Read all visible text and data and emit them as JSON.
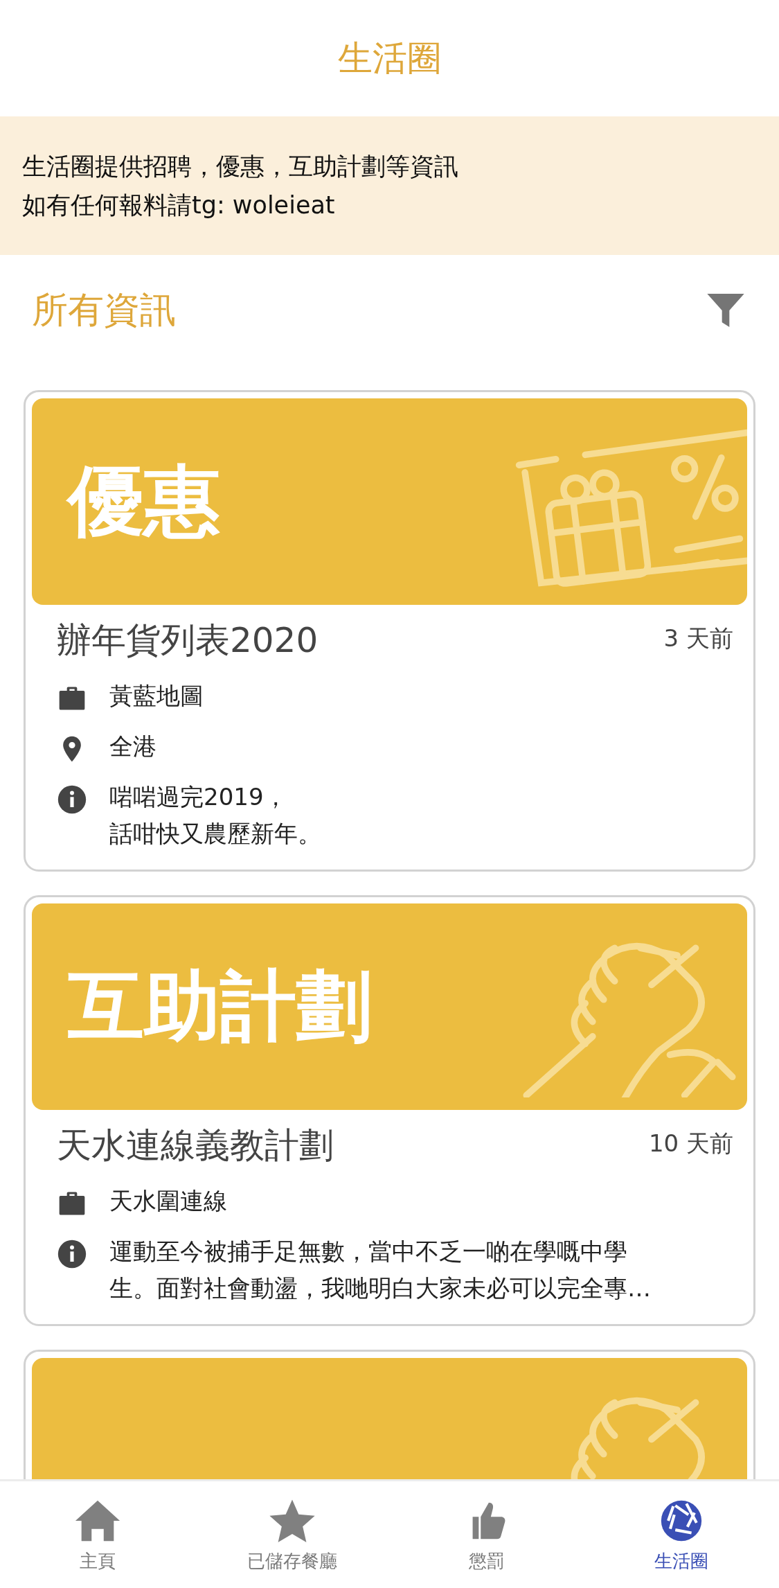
{
  "header": {
    "title": "生活圈"
  },
  "notice": {
    "lines": [
      "生活圈提供招聘，優惠，互助計劃等資訊",
      "如有任何報料請tg: woleieat"
    ]
  },
  "section": {
    "title": "所有資訊"
  },
  "cards": [
    {
      "kind": "offer",
      "banner_label": "優惠",
      "title": "辦年貨列表2020",
      "time": "3 天前",
      "rows": [
        {
          "kind": "org",
          "lines": [
            "黃藍地圖"
          ]
        },
        {
          "kind": "location",
          "lines": [
            "全港"
          ]
        },
        {
          "kind": "info",
          "lines": [
            "啱啱過完2019，",
            "話咁快又農歷新年。"
          ]
        }
      ]
    },
    {
      "kind": "help",
      "banner_label": "互助計劃",
      "title": "天水連線義教計劃",
      "time": "10 天前",
      "rows": [
        {
          "kind": "org",
          "lines": [
            "天水圍連線"
          ]
        },
        {
          "kind": "info",
          "lines": [
            "運動至今被捕手足無數，當中不乏一啲在學嘅中學",
            "生。面對社會動盪，我哋明白大家未必可以完全專…"
          ]
        }
      ]
    },
    {
      "kind": "help"
    }
  ],
  "tabs": [
    {
      "kind": "home",
      "label": "主頁",
      "selected": false
    },
    {
      "kind": "star",
      "label": "已儲存餐廳",
      "selected": false
    },
    {
      "kind": "thumb",
      "label": "懲罰",
      "selected": false
    },
    {
      "kind": "aperture",
      "label": "生活圈",
      "selected": true
    }
  ]
}
